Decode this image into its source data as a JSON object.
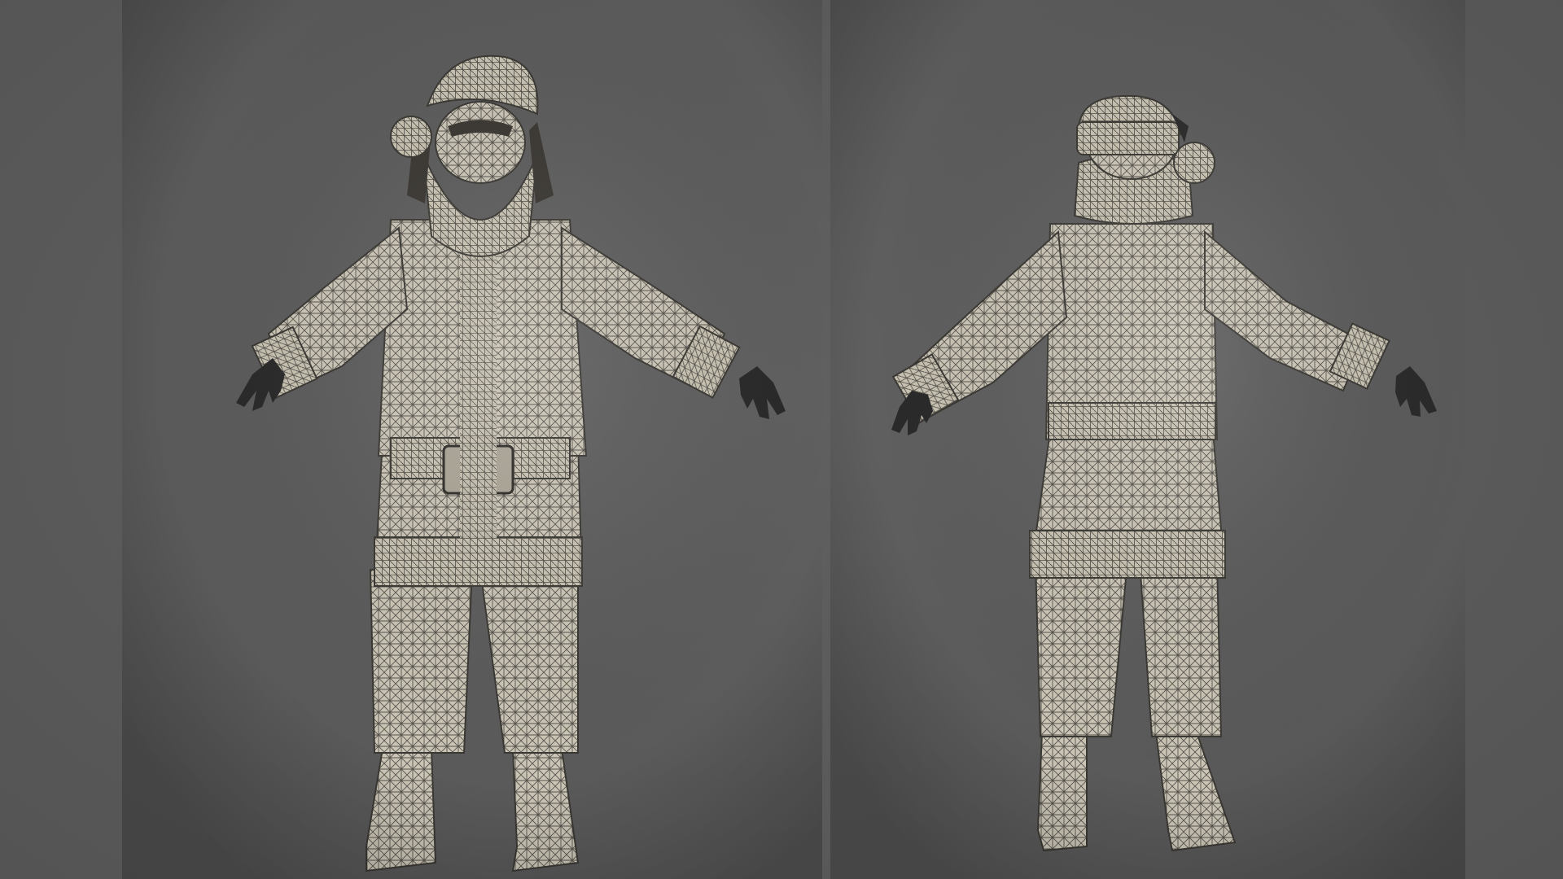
{
  "scene": {
    "background_color": "#5b5b5b",
    "mesh_color": "#cfc9bb",
    "wire_color": "#2e2c28",
    "glove_color": "#2a2a2a"
  },
  "figures": [
    {
      "view": "front",
      "icon": "santa-wireframe-front"
    },
    {
      "view": "back",
      "icon": "santa-wireframe-back"
    }
  ]
}
